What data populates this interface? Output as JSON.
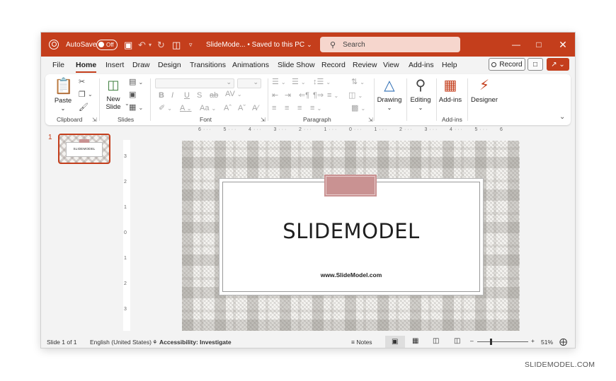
{
  "titlebar": {
    "autosave_label": "AutoSave",
    "autosave_state": "Off",
    "file_title": "SlideMode... • Saved to this PC",
    "search_placeholder": "Search"
  },
  "menu": {
    "tabs": [
      "File",
      "Home",
      "Insert",
      "Draw",
      "Design",
      "Transitions",
      "Animations",
      "Slide Show",
      "Record",
      "Review",
      "View",
      "Add-ins",
      "Help"
    ],
    "active_tab": "Home",
    "record_label": "Record"
  },
  "ribbon": {
    "clipboard": {
      "paste_label": "Paste",
      "group_label": "Clipboard"
    },
    "slides": {
      "new_slide_label_1": "New",
      "new_slide_label_2": "Slide",
      "group_label": "Slides"
    },
    "font": {
      "group_label": "Font"
    },
    "paragraph": {
      "group_label": "Paragraph"
    },
    "drawing": {
      "label": "Drawing"
    },
    "editing": {
      "label": "Editing"
    },
    "addins": {
      "label": "Add-ins",
      "group_label": "Add-ins"
    },
    "designer": {
      "label": "Designer"
    }
  },
  "ruler": {
    "h_ticks": [
      "6",
      "5",
      "4",
      "3",
      "2",
      "1",
      "0",
      "1",
      "2",
      "3",
      "4",
      "5",
      "6"
    ],
    "v_ticks": [
      "3",
      "2",
      "1",
      "0",
      "1",
      "2",
      "3"
    ]
  },
  "thumbnails": [
    {
      "number": "1",
      "title": "SLIDEMODEL"
    }
  ],
  "slide": {
    "title": "SLIDEMODEL",
    "url": "www.SlideModel.com"
  },
  "statusbar": {
    "slide_info": "Slide 1 of 1",
    "language": "English (United States)",
    "accessibility": "Accessibility: Investigate",
    "notes_label": "Notes",
    "zoom": "51%"
  },
  "watermark": "SLIDEMODEL.COM",
  "colors": {
    "accent": "#c43e1c",
    "tag": "#c99292"
  }
}
